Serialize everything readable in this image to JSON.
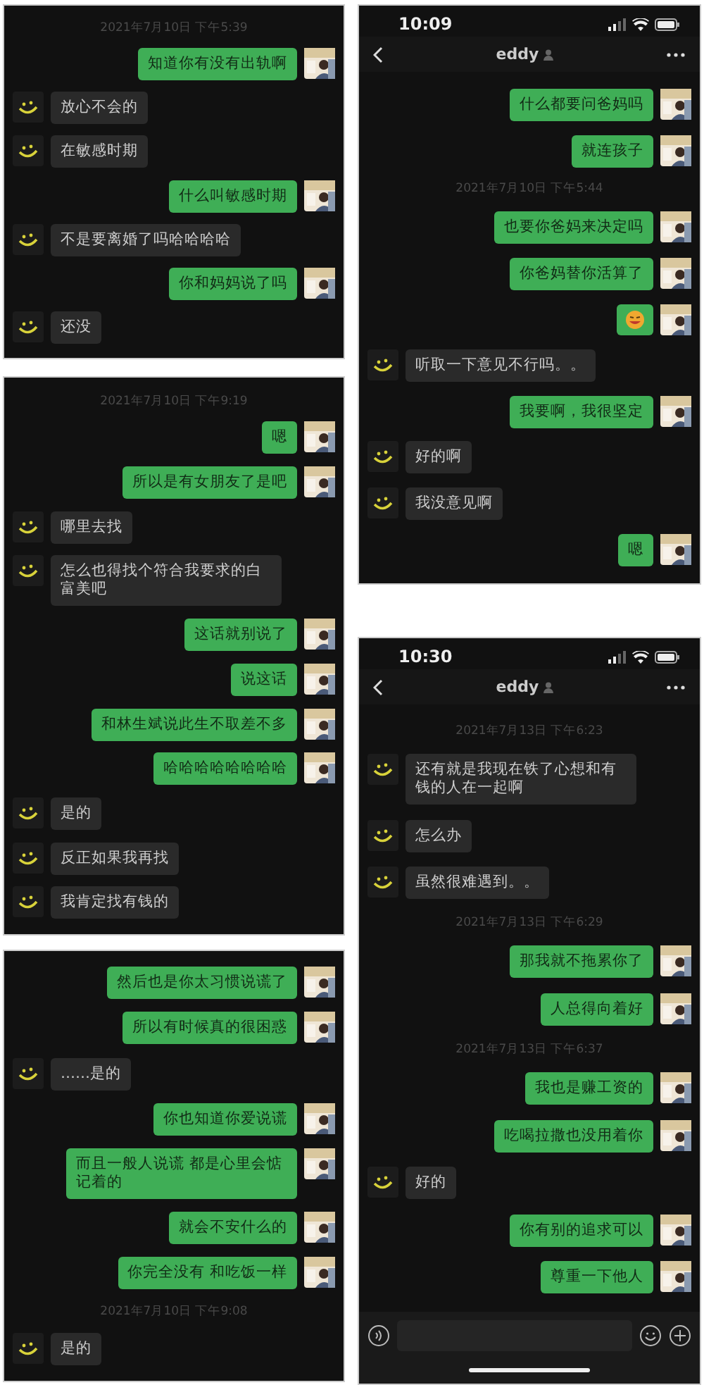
{
  "columns": [
    {
      "panels": [
        {
          "items": [
            {
              "kind": "time",
              "text": "2021年7月10日 下午5:39"
            },
            {
              "kind": "msg",
              "outgoing": true,
              "text": "知道你有没有出轨啊"
            },
            {
              "kind": "msg",
              "outgoing": false,
              "text": "放心不会的"
            },
            {
              "kind": "msg",
              "outgoing": false,
              "text": "在敏感时期"
            },
            {
              "kind": "msg",
              "outgoing": true,
              "text": "什么叫敏感时期"
            },
            {
              "kind": "msg",
              "outgoing": false,
              "text": "不是要离婚了吗哈哈哈哈"
            },
            {
              "kind": "msg",
              "outgoing": true,
              "text": "你和妈妈说了吗"
            },
            {
              "kind": "msg",
              "outgoing": false,
              "text": "还没"
            }
          ]
        },
        {
          "items": [
            {
              "kind": "time",
              "text": "2021年7月10日 下午9:19"
            },
            {
              "kind": "msg",
              "outgoing": true,
              "text": "嗯"
            },
            {
              "kind": "msg",
              "outgoing": true,
              "text": "所以是有女朋友了是吧"
            },
            {
              "kind": "msg",
              "outgoing": false,
              "text": "哪里去找"
            },
            {
              "kind": "msg",
              "outgoing": false,
              "text": "怎么也得找个符合我要求的白富美吧"
            },
            {
              "kind": "msg",
              "outgoing": true,
              "text": "这话就别说了"
            },
            {
              "kind": "msg",
              "outgoing": true,
              "text": "说这话"
            },
            {
              "kind": "msg",
              "outgoing": true,
              "text": "和林生斌说此生不取差不多"
            },
            {
              "kind": "msg",
              "outgoing": true,
              "text": "哈哈哈哈哈哈哈哈"
            },
            {
              "kind": "msg",
              "outgoing": false,
              "text": "是的"
            },
            {
              "kind": "msg",
              "outgoing": false,
              "text": "反正如果我再找"
            },
            {
              "kind": "msg",
              "outgoing": false,
              "text": "我肯定找有钱的"
            }
          ]
        },
        {
          "items": [
            {
              "kind": "msg",
              "outgoing": true,
              "text": "然后也是你太习惯说谎了"
            },
            {
              "kind": "msg",
              "outgoing": true,
              "text": "所以有时候真的很困惑"
            },
            {
              "kind": "msg",
              "outgoing": false,
              "text": "……是的"
            },
            {
              "kind": "msg",
              "outgoing": true,
              "text": "你也知道你爱说谎"
            },
            {
              "kind": "msg",
              "outgoing": true,
              "text": "而且一般人说谎 都是心里会惦记着的"
            },
            {
              "kind": "msg",
              "outgoing": true,
              "text": "就会不安什么的"
            },
            {
              "kind": "msg",
              "outgoing": true,
              "text": "你完全没有 和吃饭一样"
            },
            {
              "kind": "time",
              "text": "2021年7月10日 下午9:08"
            },
            {
              "kind": "msg",
              "outgoing": false,
              "text": "是的"
            }
          ]
        }
      ]
    },
    {
      "panels": [
        {
          "status_bar": {
            "time": "10:09"
          },
          "nav": {
            "title": "eddy"
          },
          "items": [
            {
              "kind": "msg",
              "outgoing": true,
              "text": "什么都要问爸妈吗"
            },
            {
              "kind": "msg",
              "outgoing": true,
              "text": "就连孩子"
            },
            {
              "kind": "time",
              "text": "2021年7月10日 下午5:44"
            },
            {
              "kind": "msg",
              "outgoing": true,
              "text": "也要你爸妈来决定吗"
            },
            {
              "kind": "msg",
              "outgoing": true,
              "text": "你爸妈替你活算了"
            },
            {
              "kind": "emoji",
              "outgoing": true
            },
            {
              "kind": "msg",
              "outgoing": false,
              "text": "听取一下意见不行吗。。"
            },
            {
              "kind": "msg",
              "outgoing": true,
              "text": "我要啊，我很坚定"
            },
            {
              "kind": "msg",
              "outgoing": false,
              "text": "好的啊"
            },
            {
              "kind": "msg",
              "outgoing": false,
              "text": "我没意见啊"
            },
            {
              "kind": "msg",
              "outgoing": true,
              "text": "嗯"
            }
          ]
        },
        {
          "status_bar": {
            "time": "10:30"
          },
          "nav": {
            "title": "eddy"
          },
          "input_bar": true,
          "items": [
            {
              "kind": "time",
              "text": "2021年7月13日 下午6:23"
            },
            {
              "kind": "msg",
              "outgoing": false,
              "text": "还有就是我现在铁了心想和有钱的人在一起啊"
            },
            {
              "kind": "msg",
              "outgoing": false,
              "text": "怎么办"
            },
            {
              "kind": "msg",
              "outgoing": false,
              "text": "虽然很难遇到。。"
            },
            {
              "kind": "time",
              "text": "2021年7月13日 下午6:29"
            },
            {
              "kind": "msg",
              "outgoing": true,
              "text": "那我就不拖累你了"
            },
            {
              "kind": "msg",
              "outgoing": true,
              "text": "人总得向着好"
            },
            {
              "kind": "time",
              "text": "2021年7月13日 下午6:37"
            },
            {
              "kind": "msg",
              "outgoing": true,
              "text": "我也是赚工资的"
            },
            {
              "kind": "msg",
              "outgoing": true,
              "text": "吃喝拉撒也没用着你"
            },
            {
              "kind": "msg",
              "outgoing": false,
              "text": "好的"
            },
            {
              "kind": "msg",
              "outgoing": true,
              "text": "你有别的追求可以"
            },
            {
              "kind": "msg",
              "outgoing": true,
              "text": "尊重一下他人"
            }
          ]
        }
      ]
    }
  ]
}
